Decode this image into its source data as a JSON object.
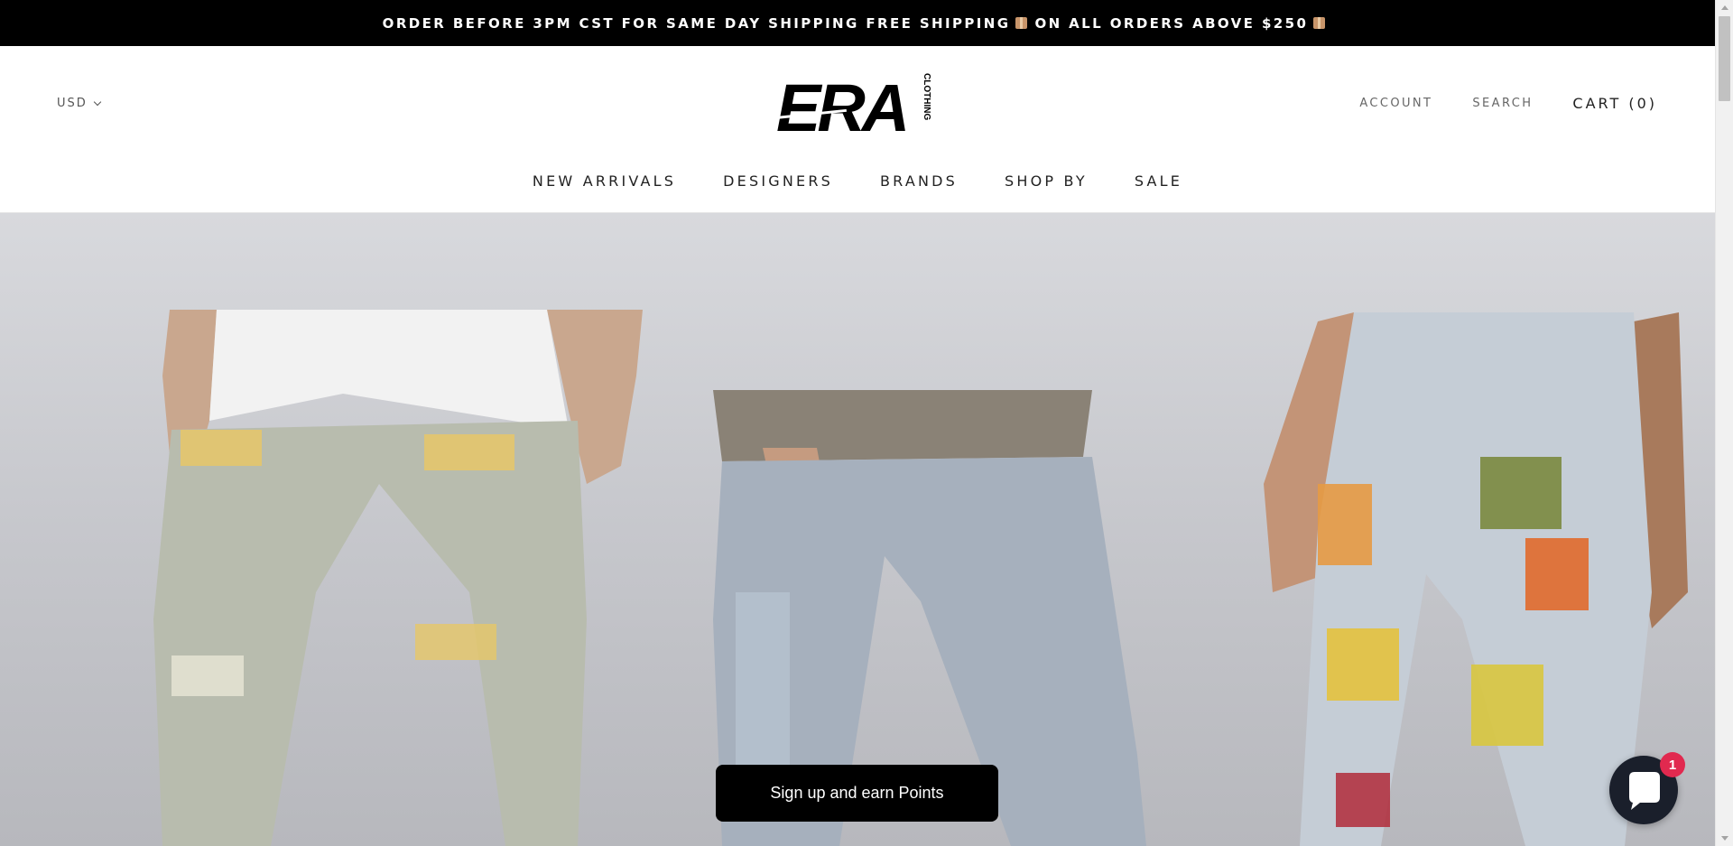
{
  "announcement": {
    "part1": "ORDER BEFORE 3PM CST FOR SAME DAY SHIPPING FREE SHIPPING",
    "part2": "ON ALL ORDERS ABOVE $250"
  },
  "header": {
    "currency": "USD",
    "logo_text": "ERA",
    "logo_subtext": "CLOTHING",
    "links": {
      "account": "ACCOUNT",
      "search": "SEARCH",
      "cart": "CART (0)"
    }
  },
  "nav": {
    "items": [
      "NEW ARRIVALS",
      "DESIGNERS",
      "BRANDS",
      "SHOP BY",
      "SALE"
    ]
  },
  "hero": {
    "image_alt": "Three models wearing distressed light-wash skinny jeans"
  },
  "rewards": {
    "signup_label": "Sign up and earn Points"
  },
  "chat": {
    "badge_count": "1"
  },
  "colors": {
    "announcement_bg": "#000000",
    "signup_bg": "#000000",
    "chat_bg": "#1a1f2b",
    "badge_bg": "#e1294f"
  }
}
